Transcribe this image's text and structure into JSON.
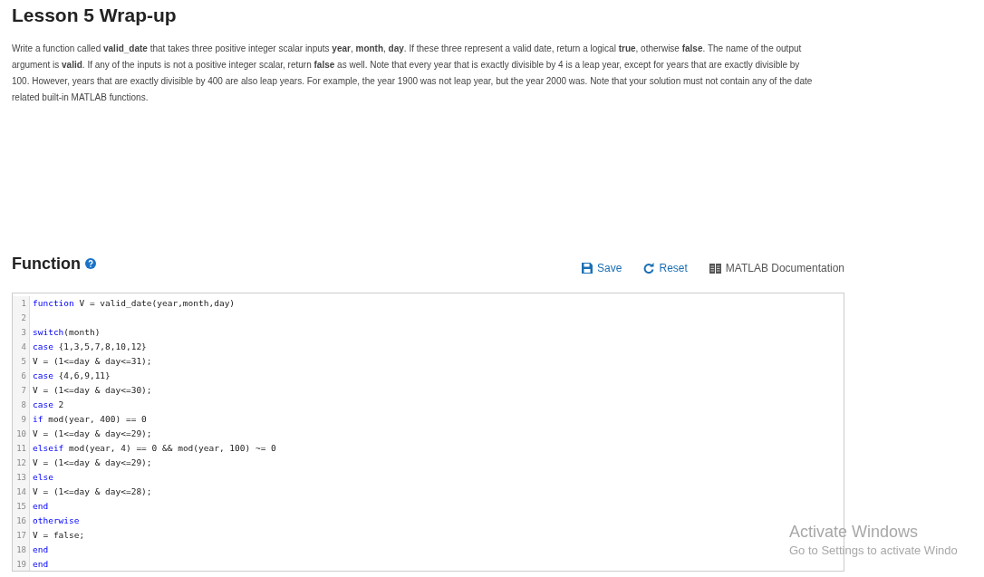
{
  "title": "Lesson 5 Wrap-up",
  "description": "Write a function called **valid_date** that takes three positive integer scalar inputs **year**, **month**, **day**. If these three represent a valid date, return a logical **true**, otherwise **false**. The name of the output argument is **valid**. If any of the inputs is not a positive integer scalar, return **false** as well. Note that every year that is exactly divisible by 4 is a leap year, except for years that are exactly divisible by 100. However, years that are exactly divisible by 400 are also leap years. For example, the year 1900 was not leap year, but the year 2000 was. Note that your solution must not contain any of the date related built-in MATLAB functions.",
  "section": {
    "title": "Function"
  },
  "toolbar": [
    {
      "kind": "save",
      "label": "Save"
    },
    {
      "kind": "reset",
      "label": "Reset"
    },
    {
      "kind": "docs",
      "label": "MATLAB Documentation"
    }
  ],
  "code_lines": [
    {
      "number": "1",
      "tokens": [
        {
          "kind": "keyword",
          "text": "function"
        },
        {
          "kind": "plain",
          "text": " V = valid_date(year,month,day)"
        }
      ]
    },
    {
      "number": "2"
    },
    {
      "number": "3",
      "tokens": [
        {
          "kind": "keyword",
          "text": "switch"
        },
        {
          "kind": "plain",
          "text": "(month)"
        }
      ]
    },
    {
      "number": "4",
      "tokens": [
        {
          "kind": "keyword",
          "text": "case"
        },
        {
          "kind": "plain",
          "text": " {1,3,5,7,8,10,12}"
        }
      ]
    },
    {
      "number": "5",
      "tokens": [
        {
          "kind": "plain",
          "text": "V = (1<=day & day<=31);"
        }
      ]
    },
    {
      "number": "6",
      "tokens": [
        {
          "kind": "keyword",
          "text": "case"
        },
        {
          "kind": "plain",
          "text": " {4,6,9,11}"
        }
      ]
    },
    {
      "number": "7",
      "tokens": [
        {
          "kind": "plain",
          "text": "V = (1<=day & day<=30);"
        }
      ]
    },
    {
      "number": "8",
      "tokens": [
        {
          "kind": "keyword",
          "text": "case"
        },
        {
          "kind": "plain",
          "text": " 2"
        }
      ]
    },
    {
      "number": "9",
      "tokens": [
        {
          "kind": "keyword",
          "text": "if"
        },
        {
          "kind": "plain",
          "text": " mod(year, 400) == 0"
        }
      ]
    },
    {
      "number": "10",
      "tokens": [
        {
          "kind": "plain",
          "text": "V = (1<=day & day<=29);"
        }
      ]
    },
    {
      "number": "11",
      "tokens": [
        {
          "kind": "keyword",
          "text": "elseif"
        },
        {
          "kind": "plain",
          "text": " mod(year, 4) == 0 && mod(year, 100) ~= 0"
        }
      ]
    },
    {
      "number": "12",
      "tokens": [
        {
          "kind": "plain",
          "text": "V = (1<=day & day<=29);"
        }
      ]
    },
    {
      "number": "13",
      "tokens": [
        {
          "kind": "keyword",
          "text": "else"
        }
      ]
    },
    {
      "number": "14",
      "tokens": [
        {
          "kind": "plain",
          "text": "V = (1<=day & day<=28);"
        }
      ]
    },
    {
      "number": "15",
      "tokens": [
        {
          "kind": "keyword",
          "text": "end"
        }
      ]
    },
    {
      "number": "16",
      "tokens": [
        {
          "kind": "keyword",
          "text": "otherwise"
        }
      ]
    },
    {
      "number": "17",
      "tokens": [
        {
          "kind": "plain",
          "text": "V = false;"
        }
      ]
    },
    {
      "number": "18",
      "tokens": [
        {
          "kind": "keyword",
          "text": "end"
        }
      ]
    },
    {
      "number": "19",
      "tokens": [
        {
          "kind": "keyword",
          "text": "end"
        }
      ]
    }
  ],
  "os_notice": {
    "title": "Activate Windows",
    "subtitle": "Go to Settings to activate Windo"
  }
}
